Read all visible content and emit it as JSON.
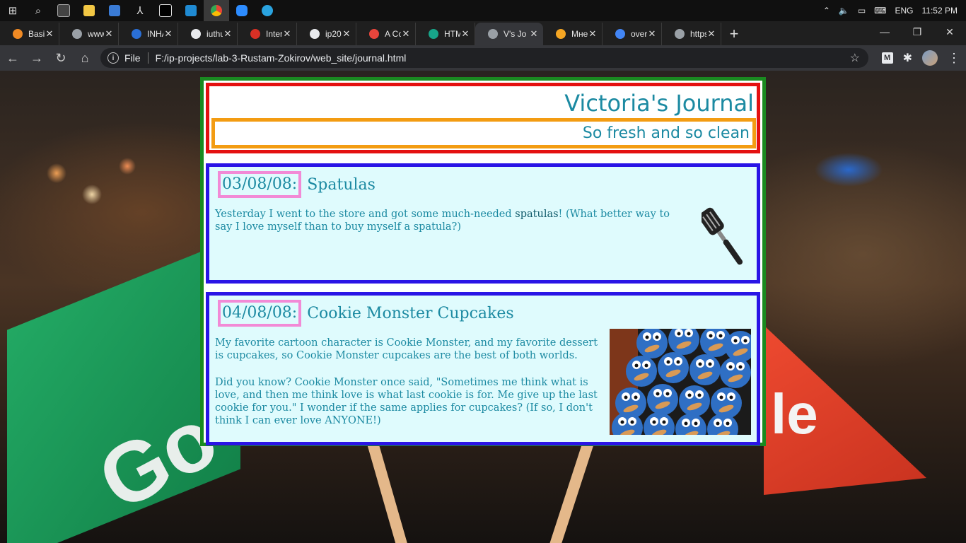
{
  "taskbar": {
    "tray": {
      "language": "ENG",
      "time": "11:52 PM"
    }
  },
  "browser": {
    "tabs": [
      {
        "label": "Basics",
        "color": "#f08a24"
      },
      {
        "label": "www.",
        "color": "#9aa0a6"
      },
      {
        "label": "INHA",
        "color": "#2a6fd6"
      },
      {
        "label": "iuthul",
        "color": "#e8eaed"
      },
      {
        "label": "Intern",
        "color": "#d93025"
      },
      {
        "label": "ip202",
        "color": "#e8eaed"
      },
      {
        "label": "A Cor",
        "color": "#e8453c"
      },
      {
        "label": "HTML",
        "color": "#17a589"
      },
      {
        "label": "V's Jo",
        "color": "#9aa0a6",
        "active": true
      },
      {
        "label": "Мне",
        "color": "#f5a623"
      },
      {
        "label": "overfl",
        "color": "#4285f4"
      },
      {
        "label": "https:",
        "color": "#9aa0a6"
      }
    ],
    "address": {
      "scheme": "File",
      "url": "F:/ip-projects/lab-3-Rustam-Zokirov/web_site/journal.html"
    },
    "extension_label": "M"
  },
  "page": {
    "title": "Victoria's Journal",
    "slogan": "So fresh and so clean",
    "entries": [
      {
        "date": "03/08/08:",
        "title": "Spatulas",
        "text_before": "Yesterday I went to the store and got some much-needed ",
        "text_emph": "spatulas",
        "text_after": "! (What better way to say I love myself than to buy myself a spatula?)"
      },
      {
        "date": "04/08/08:",
        "title": "Cookie Monster Cupcakes",
        "paragraph1": "My favorite cartoon character is Cookie Monster, and my favorite dessert is cupcakes, so Cookie Monster cupcakes are the best of both worlds.",
        "paragraph2": "Did you know? Cookie Monster once said, \"Sometimes me think what is love, and then me think love is what last cookie is for. Me give up the last cookie for you.\" I wonder if the same applies for cupcakes? (If so, I don't think I can ever love ANYONE!)"
      }
    ]
  },
  "background": {
    "flag_left_text": "Go",
    "flag_right_text": "le"
  }
}
